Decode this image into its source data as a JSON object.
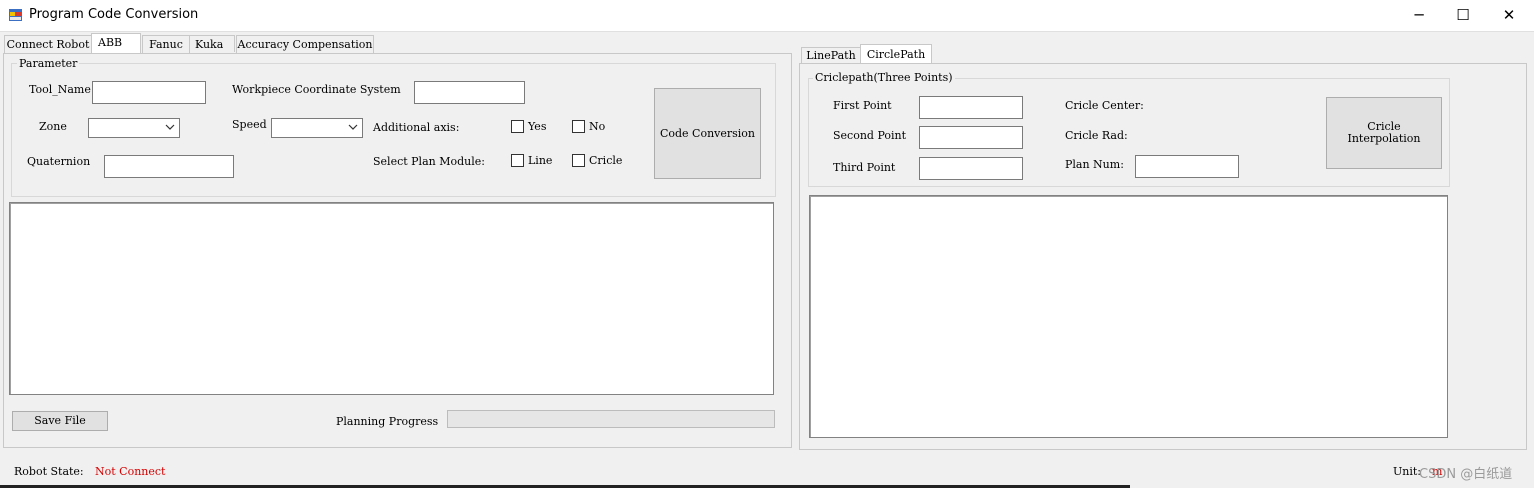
{
  "window": {
    "title": "Program Code Conversion",
    "minimize_glyph": "─",
    "maximize_glyph": "☐",
    "close_glyph": "✕"
  },
  "main_tabs": [
    {
      "label": "Connect Robot",
      "active": false
    },
    {
      "label": "ABB",
      "active": true
    },
    {
      "label": "Fanuc",
      "active": false
    },
    {
      "label": "Kuka",
      "active": false
    },
    {
      "label": "Accuracy Compensation",
      "active": false
    }
  ],
  "parameter": {
    "legend": "Parameter",
    "tool_name_label": "Tool_Name",
    "tool_name_value": "",
    "workpiece_label": "Workpiece Coordinate System",
    "workpiece_value": "",
    "zone_label": "Zone",
    "zone_value": "",
    "speed_label": "Speed",
    "speed_value": "",
    "additional_axis_label": "Additional axis:",
    "yes_label": "Yes",
    "no_label": "No",
    "quaternion_label": "Quaternion",
    "quaternion_value": "",
    "select_plan_label": "Select Plan Module:",
    "line_label": "Line",
    "circle_label": "Cricle",
    "code_conversion_label": "Code Conversion"
  },
  "left_output": "",
  "save_file_label": "Save File",
  "planning_progress_label": "Planning Progress",
  "planning_progress_value": 0,
  "path_tabs": [
    {
      "label": "LinePath",
      "active": false
    },
    {
      "label": "CirclePath",
      "active": true
    }
  ],
  "circle_path": {
    "legend": "Criclepath(Three Points)",
    "first_point_label": "First Point",
    "first_point_value": "",
    "second_point_label": "Second Point",
    "second_point_value": "",
    "third_point_label": "Third Point",
    "third_point_value": "",
    "center_label": "Cricle Center:",
    "rad_label": "Cricle Rad:",
    "plan_num_label": "Plan Num:",
    "plan_num_value": "",
    "interp_line1": "Cricle",
    "interp_line2": "Interpolation"
  },
  "right_output": "",
  "status": {
    "robot_state_label": "Robot State:",
    "robot_state_value": "Not Connect",
    "unit_label": "Unit:",
    "unit_value": "m",
    "watermark": "CSDN @白纸道"
  },
  "colors": {
    "error_red": "#d40000",
    "window_bg": "#f0f0f0"
  }
}
